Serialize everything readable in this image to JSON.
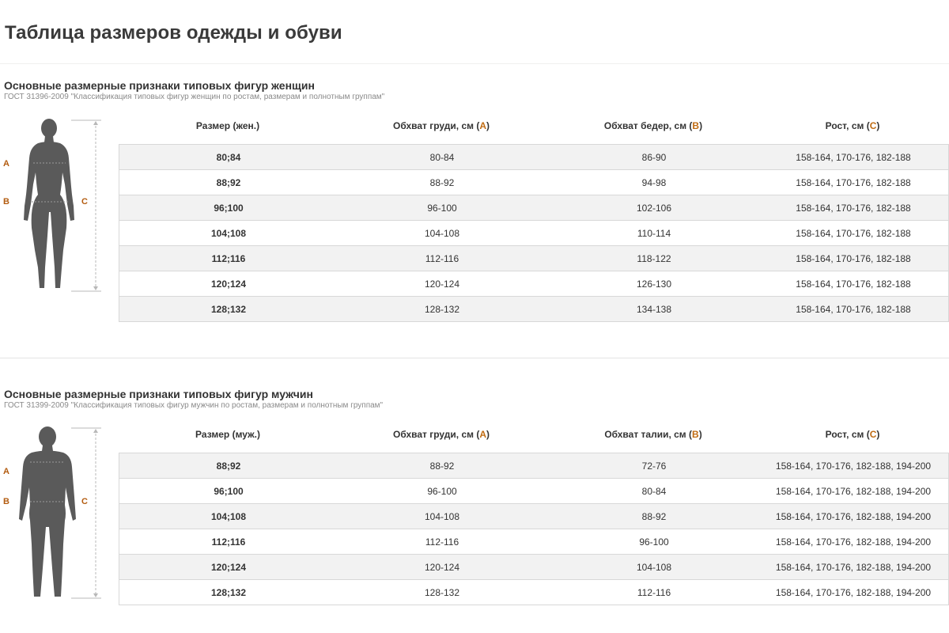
{
  "page": {
    "title": "Таблица размеров одежды и обуви"
  },
  "women": {
    "title": "Основные размерные признаки типовых фигур женщин",
    "subtitle": "ГОСТ 31396-2009 \"Классификация типовых фигур женщин по ростам, размерам и полнотным группам\"",
    "figure_letters": {
      "a": "A",
      "b": "B",
      "c": "C"
    },
    "headers": {
      "size": "Размер (жен.)",
      "chest_prefix": "Обхват груди, см (",
      "chest_letter": "А",
      "chest_suffix": ")",
      "hips_prefix": "Обхват бедер, см (",
      "hips_letter": "В",
      "hips_suffix": ")",
      "height_prefix": "Рост, см (",
      "height_letter": "С",
      "height_suffix": ")"
    },
    "rows": [
      {
        "size": "80;84",
        "chest": "80-84",
        "hips": "86-90",
        "height": "158-164, 170-176, 182-188"
      },
      {
        "size": "88;92",
        "chest": "88-92",
        "hips": "94-98",
        "height": "158-164, 170-176, 182-188"
      },
      {
        "size": "96;100",
        "chest": "96-100",
        "hips": "102-106",
        "height": "158-164, 170-176, 182-188"
      },
      {
        "size": "104;108",
        "chest": "104-108",
        "hips": "110-114",
        "height": "158-164, 170-176, 182-188"
      },
      {
        "size": "112;116",
        "chest": "112-116",
        "hips": "118-122",
        "height": "158-164, 170-176, 182-188"
      },
      {
        "size": "120;124",
        "chest": "120-124",
        "hips": "126-130",
        "height": "158-164, 170-176, 182-188"
      },
      {
        "size": "128;132",
        "chest": "128-132",
        "hips": "134-138",
        "height": "158-164, 170-176, 182-188"
      }
    ]
  },
  "men": {
    "title": "Основные размерные признаки типовых фигур мужчин",
    "subtitle": "ГОСТ 31399-2009 \"Классификация типовых фигур мужчин по ростам, размерам и полнотным группам\"",
    "figure_letters": {
      "a": "A",
      "b": "B",
      "c": "C"
    },
    "headers": {
      "size": "Размер (муж.)",
      "chest_prefix": "Обхват груди, см (",
      "chest_letter": "А",
      "chest_suffix": ")",
      "waist_prefix": "Обхват талии, см (",
      "waist_letter": "В",
      "waist_suffix": ")",
      "height_prefix": "Рост, см (",
      "height_letter": "С",
      "height_suffix": ")"
    },
    "rows": [
      {
        "size": "88;92",
        "chest": "88-92",
        "waist": "72-76",
        "height": "158-164, 170-176, 182-188, 194-200"
      },
      {
        "size": "96;100",
        "chest": "96-100",
        "waist": "80-84",
        "height": "158-164, 170-176, 182-188, 194-200"
      },
      {
        "size": "104;108",
        "chest": "104-108",
        "waist": "88-92",
        "height": "158-164, 170-176, 182-188, 194-200"
      },
      {
        "size": "112;116",
        "chest": "112-116",
        "waist": "96-100",
        "height": "158-164, 170-176, 182-188, 194-200"
      },
      {
        "size": "120;124",
        "chest": "120-124",
        "waist": "104-108",
        "height": "158-164, 170-176, 182-188, 194-200"
      },
      {
        "size": "128;132",
        "chest": "128-132",
        "waist": "112-116",
        "height": "158-164, 170-176, 182-188, 194-200"
      }
    ]
  },
  "colors": {
    "accent_letter": "#c06b12",
    "figure": "#5a5a5a",
    "row_alt": "#f2f2f2"
  }
}
